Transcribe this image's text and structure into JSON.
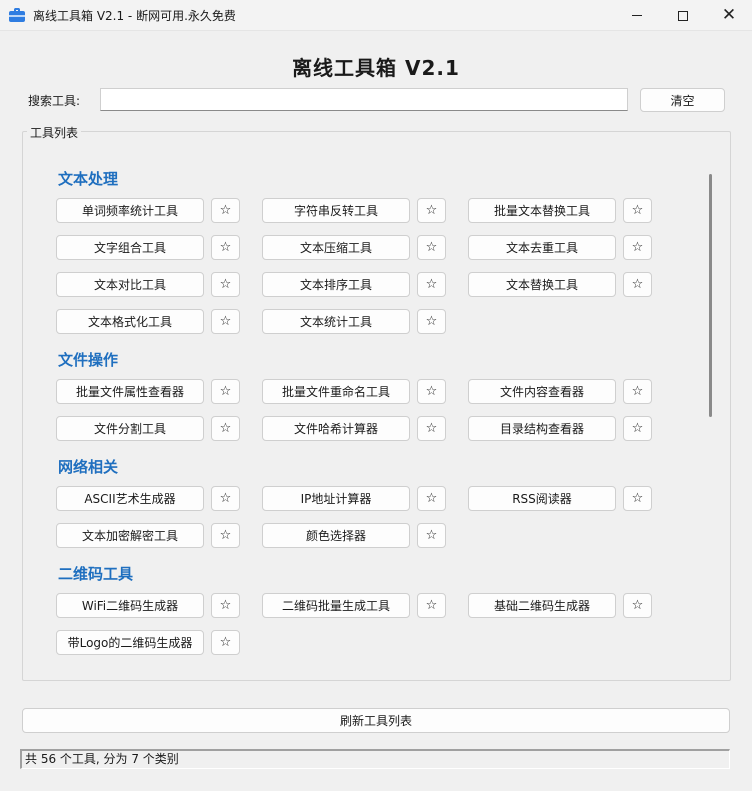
{
  "window": {
    "title": "离线工具箱 V2.1 - 断网可用.永久免费",
    "icon": "toolbox-icon",
    "accent_color": "#2f7de1"
  },
  "header": {
    "title": "离线工具箱 V2.1"
  },
  "search": {
    "label": "搜索工具:",
    "value": "",
    "placeholder": "",
    "clear_label": "清空"
  },
  "tool_list": {
    "group_label": "工具列表",
    "category_color": "#1f6fbf",
    "star_symbol": "☆",
    "categories": [
      {
        "name": "文本处理",
        "tools": [
          "单词频率统计工具",
          "字符串反转工具",
          "批量文本替换工具",
          "文字组合工具",
          "文本压缩工具",
          "文本去重工具",
          "文本对比工具",
          "文本排序工具",
          "文本替换工具",
          "文本格式化工具",
          "文本统计工具"
        ]
      },
      {
        "name": "文件操作",
        "tools": [
          "批量文件属性查看器",
          "批量文件重命名工具",
          "文件内容查看器",
          "文件分割工具",
          "文件哈希计算器",
          "目录结构查看器"
        ]
      },
      {
        "name": "网络相关",
        "tools": [
          "ASCII艺术生成器",
          "IP地址计算器",
          "RSS阅读器",
          "文本加密解密工具",
          "颜色选择器"
        ]
      },
      {
        "name": "二维码工具",
        "tools": [
          "WiFi二维码生成器",
          "二维码批量生成工具",
          "基础二维码生成器",
          "带Logo的二维码生成器"
        ]
      }
    ]
  },
  "footer": {
    "refresh_label": "刷新工具列表",
    "status": "共 56 个工具, 分为 7 个类别"
  }
}
